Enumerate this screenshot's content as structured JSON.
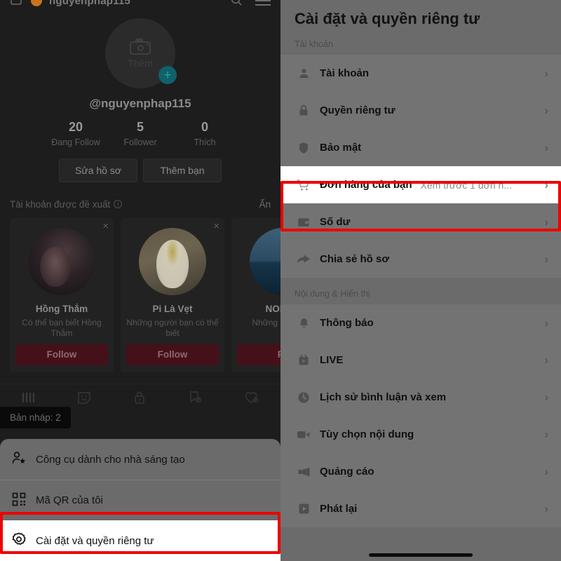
{
  "left": {
    "topbar": {
      "back_icon": "rectangle-icon",
      "status_dot": "orange-dot-icon",
      "title": "nguyenphap115",
      "search_icon": "search-icon",
      "menu_icon": "hamburger-menu-icon"
    },
    "profile": {
      "avatar_label": "Thêm",
      "avatar_icon": "camera-icon",
      "add_badge": "+",
      "handle": "@nguyenphap115",
      "stats": [
        {
          "number": "20",
          "label": "Đang Follow"
        },
        {
          "number": "5",
          "label": "Follower"
        },
        {
          "number": "0",
          "label": "Thích"
        }
      ],
      "buttons": [
        {
          "label": "Sửa hồ sơ"
        },
        {
          "label": "Thêm bạn"
        }
      ]
    },
    "suggested": {
      "title": "Tài khoản được đề xuất",
      "info_glyph": "i",
      "hide_label": "Ẩn",
      "close_glyph": "×",
      "cards": [
        {
          "name": "Hồng Thắm",
          "subtitle": "Có thể bạn biết Hồng Thắm",
          "follow_label": "Follow",
          "art": "av-a"
        },
        {
          "name": "Pi Là Vẹt",
          "subtitle": "Những người bạn có thể biết",
          "follow_label": "Follow",
          "art": "av-b"
        },
        {
          "name": "NORMA",
          "subtitle": "Những ngườ thể",
          "follow_label": "Fo",
          "art": "av-c"
        }
      ]
    },
    "tabs": [
      {
        "icon": "grid-posts-icon",
        "active": true
      },
      {
        "icon": "sticker-smiley-icon",
        "active": false
      },
      {
        "icon": "lock-private-icon",
        "active": false
      },
      {
        "icon": "bookmark-saved-icon",
        "active": false
      },
      {
        "icon": "heart-liked-icon",
        "active": false
      }
    ],
    "draft_chip": "Bản nháp: 2",
    "sheet": [
      {
        "icon": "creator-tools-icon",
        "label": "Công cụ dành cho nhà sáng tạo",
        "highlight": false
      },
      {
        "icon": "qr-code-icon",
        "label": "Mã QR của tôi",
        "highlight": false
      },
      {
        "icon": "gear-settings-icon",
        "label": "Cài đặt và quyền riêng tư",
        "highlight": true
      }
    ]
  },
  "right": {
    "title": "Cài đặt và quyền riêng tư",
    "sections": [
      {
        "label": "Tài khoản",
        "rows": [
          {
            "icon": "person-icon",
            "label": "Tài khoản",
            "value": "",
            "highlight": false
          },
          {
            "icon": "lock-icon",
            "label": "Quyền riêng tư",
            "value": "",
            "highlight": false
          },
          {
            "icon": "shield-icon",
            "label": "Bảo mật",
            "value": "",
            "highlight": false
          },
          {
            "icon": "cart-icon",
            "label": "Đơn hàng của bạn",
            "value": "Xem trước 1 đơn h...",
            "highlight": true
          },
          {
            "icon": "wallet-icon",
            "label": "Số dư",
            "value": "",
            "highlight": false
          },
          {
            "icon": "share-arrow-icon",
            "label": "Chia sẻ hồ sơ",
            "value": "",
            "highlight": false
          }
        ]
      },
      {
        "label": "Nội dung & Hiển thị",
        "rows": [
          {
            "icon": "bell-icon",
            "label": "Thông báo",
            "value": "",
            "highlight": false
          },
          {
            "icon": "live-tv-icon",
            "label": "LIVE",
            "value": "",
            "highlight": false
          },
          {
            "icon": "clock-history-icon",
            "label": "Lịch sử bình luận và xem",
            "value": "",
            "highlight": false
          },
          {
            "icon": "video-camera-icon",
            "label": "Tùy chọn nội dung",
            "value": "",
            "highlight": false
          },
          {
            "icon": "megaphone-icon",
            "label": "Quảng cáo",
            "value": "",
            "highlight": false
          },
          {
            "icon": "play-square-icon",
            "label": "Phát lại",
            "value": "",
            "highlight": false
          }
        ]
      }
    ],
    "chevron": "›"
  },
  "colors": {
    "highlight_border": "#ee0000",
    "highlight_fill": "#ffffff",
    "dim_overlay": "#6b6b6b",
    "follow_button": "#46101a",
    "add_badge": "#10616b"
  }
}
